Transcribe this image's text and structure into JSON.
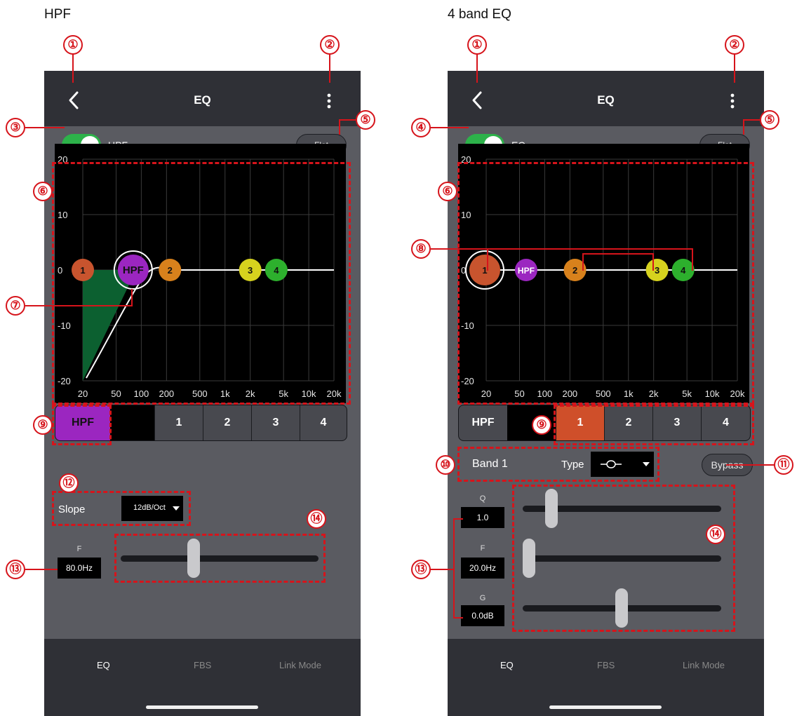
{
  "captions": {
    "left": "HPF",
    "right": "4 band EQ"
  },
  "common": {
    "title": "EQ",
    "flat_label": "Flat",
    "tabs": [
      "EQ",
      "FBS",
      "Link Mode"
    ],
    "y_ticks": [
      "20",
      "10",
      "0",
      "-10",
      "-20"
    ],
    "x_ticks": [
      "20",
      "50",
      "100",
      "200",
      "500",
      "1k",
      "2k",
      "5k",
      "10k",
      "20k"
    ],
    "bands": [
      "HPF",
      "1",
      "2",
      "3",
      "4"
    ]
  },
  "left": {
    "toggle_label": "HPF",
    "selected_band": "HPF",
    "slope_label": "Slope",
    "slope_value": "12dB/Oct",
    "f_label": "F",
    "f_value": "80.0Hz",
    "f_slider": 0.37
  },
  "right": {
    "toggle_label": "EQ",
    "selected_band": "1",
    "band_name": "Band 1",
    "type_label": "Type",
    "bypass_label": "Bypass",
    "params": [
      {
        "label": "Q",
        "value": "1.0",
        "slider": 0.12
      },
      {
        "label": "F",
        "value": "20.0Hz",
        "slider": 0.0
      },
      {
        "label": "G",
        "value": "0.0dB",
        "slider": 0.5
      }
    ]
  },
  "callouts": {
    "c1": "①",
    "c2": "②",
    "c3": "③",
    "c4": "④",
    "c5": "⑤",
    "c6": "⑥",
    "c7": "⑦",
    "c8": "⑧",
    "c9": "⑨",
    "c10": "⑩",
    "c11": "⑪",
    "c12": "⑫",
    "c13": "⑬",
    "c14": "⑭"
  },
  "colors": {
    "band1": "#c8542e",
    "band2": "#d8811c",
    "band3": "#d6d21e",
    "band4": "#2db02d",
    "hpf": "#9b26c0",
    "hpf_fill": "#0c6030",
    "selected_bg": "#cf4f2a",
    "accent_red": "#d6141b"
  }
}
